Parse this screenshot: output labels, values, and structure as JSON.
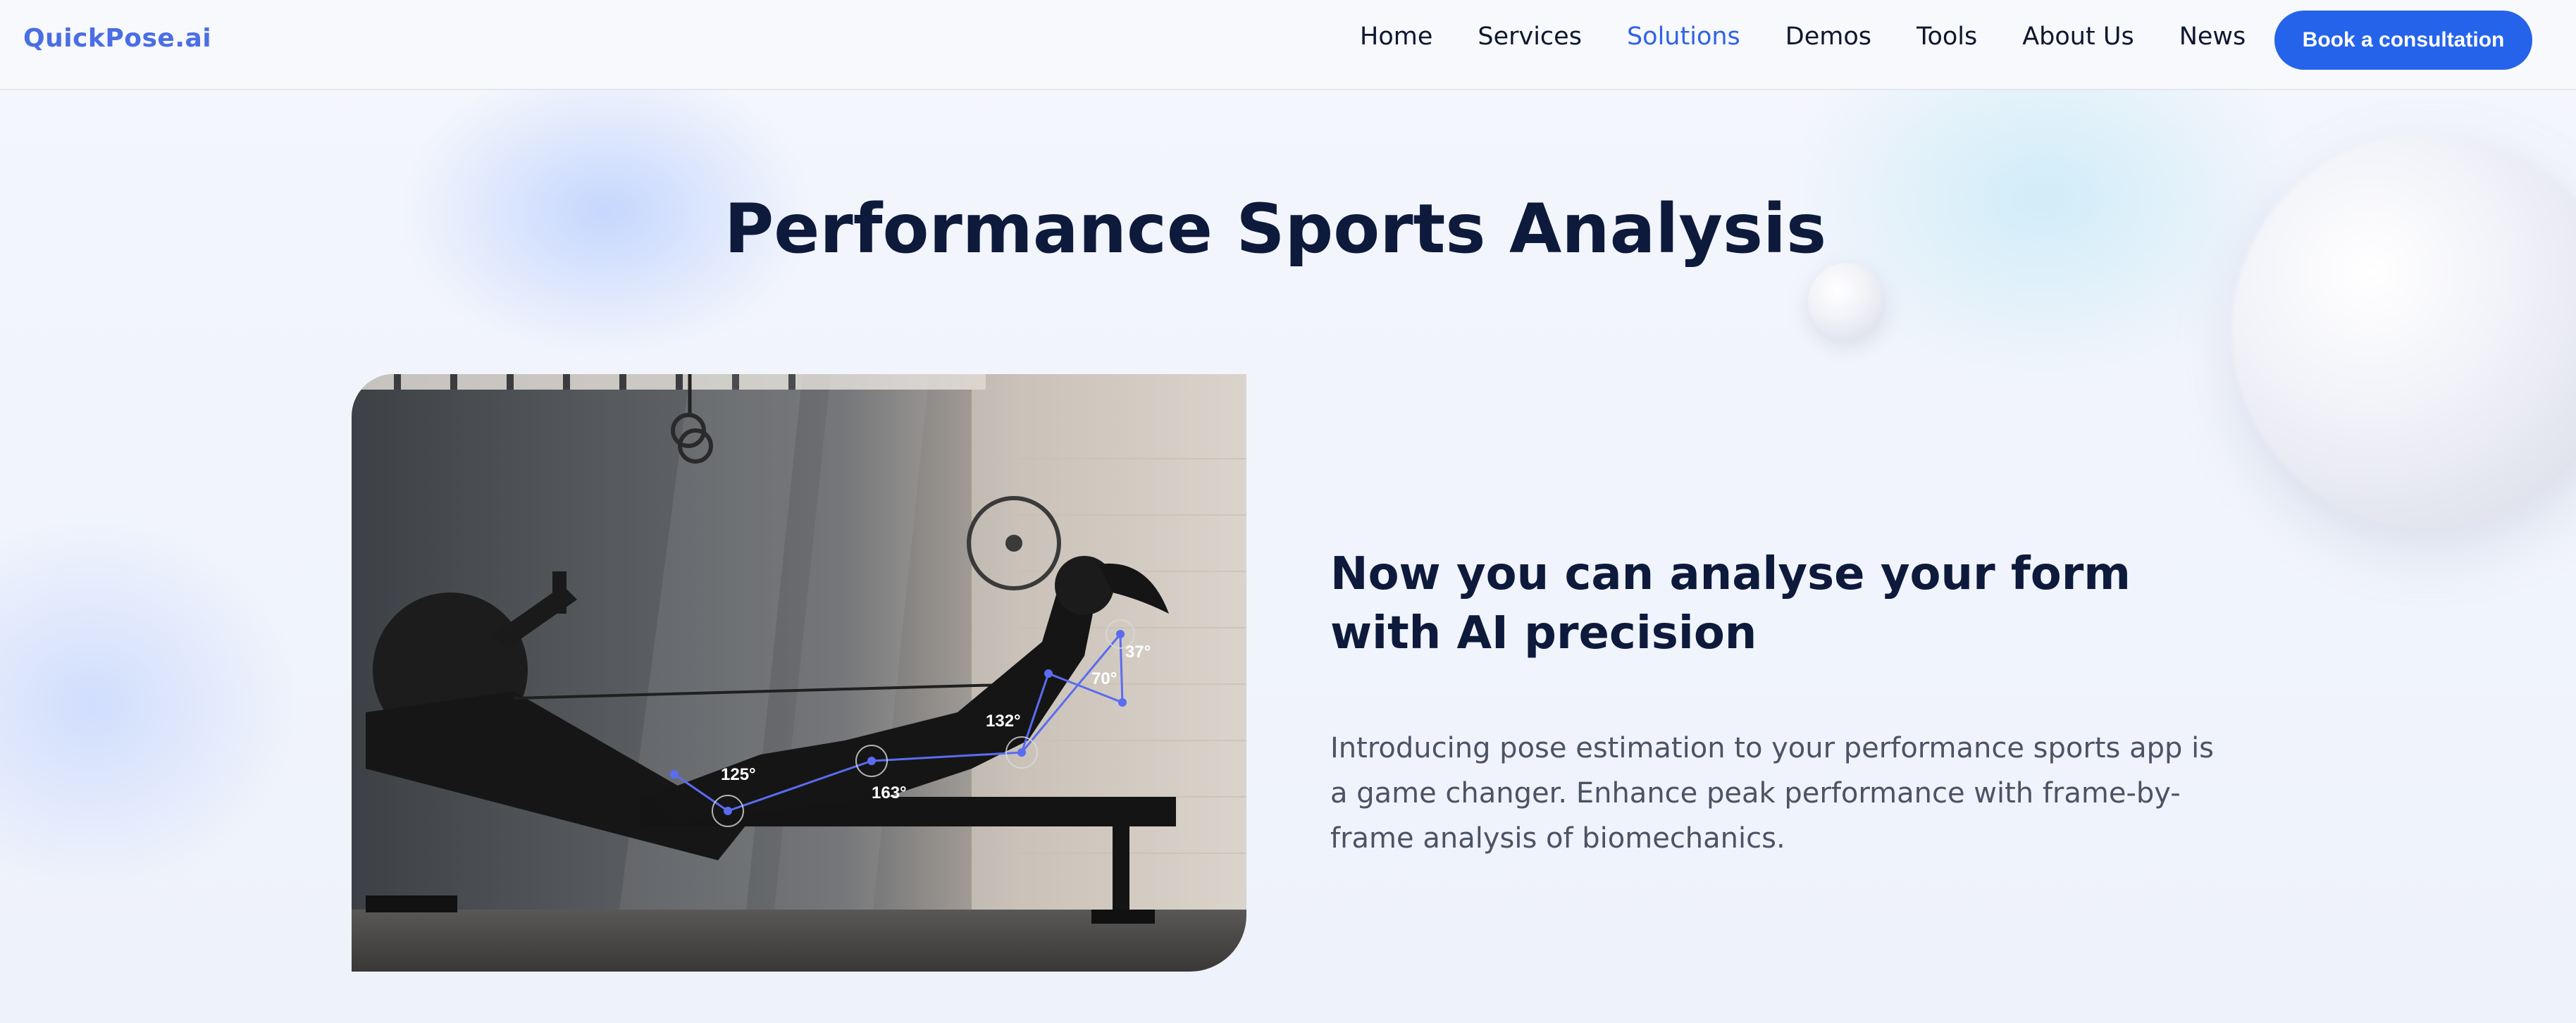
{
  "header": {
    "logo": "QuickPose.ai",
    "nav": [
      {
        "label": "Home",
        "active": false
      },
      {
        "label": "Services",
        "active": false
      },
      {
        "label": "Solutions",
        "active": true
      },
      {
        "label": "Demos",
        "active": false
      },
      {
        "label": "Tools",
        "active": false
      },
      {
        "label": "About Us",
        "active": false
      },
      {
        "label": "News",
        "active": false
      }
    ],
    "cta_label": "Book a consultation"
  },
  "hero": {
    "title": "Performance Sports Analysis",
    "subhead": "Now you can analyse your form with AI precision",
    "description": "Introducing pose estimation to your performance sports app is a game changer. Enhance peak performance with frame-by-frame analysis of biomechanics."
  },
  "image": {
    "alt": "Athlete on rowing machine with pose estimation overlay",
    "angles": [
      "125°",
      "163°",
      "132°",
      "70°",
      "37°"
    ]
  },
  "colors": {
    "accent": "#2563eb",
    "active_nav": "#2f63e6",
    "heading": "#0d1a3c",
    "overlay_line": "#5a6cf0"
  }
}
